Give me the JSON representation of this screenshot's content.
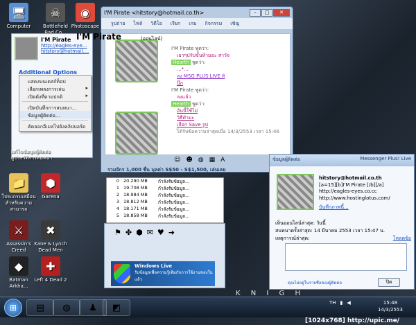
{
  "desktop_icons": [
    {
      "label": "Computer",
      "icon": "computer-icon",
      "glyph": "🖥",
      "color": "#5b8fd1"
    },
    {
      "label": "Battlefield Bad Co...",
      "icon": "game-icon",
      "glyph": "☠",
      "color": "#555555"
    },
    {
      "label": "Photoscape",
      "icon": "photoscape-icon",
      "glyph": "◉",
      "color": "#e04a3a"
    },
    {
      "label": "โปรแกรมเสมือน สำหรับความสามารถ",
      "icon": "folder-icon",
      "glyph": "📁",
      "color": "#e8c35a"
    },
    {
      "label": "Garena",
      "icon": "garena-icon",
      "glyph": "⬢",
      "color": "#c0282b"
    },
    {
      "label": "Assassin's Creed",
      "icon": "assassin-icon",
      "glyph": "⚔",
      "color": "#7a1d1d"
    },
    {
      "label": "Kane & Lynch Dead Men",
      "icon": "kane-lynch-icon",
      "glyph": "✖",
      "color": "#3a3a3a"
    },
    {
      "label": "Batman Arkha...",
      "icon": "batman-icon",
      "glyph": "◆",
      "color": "#222222"
    },
    {
      "label": "Left 4 Dead 2",
      "icon": "left4dead-icon",
      "glyph": "✚",
      "color": "#b32020"
    }
  ],
  "contact_card": {
    "name": "I'M Pirate",
    "link": "http://eagles-eye...",
    "email": "hitstory@hotmail....",
    "additional_options": "Additional Options",
    "footer_line1": "แก้ไขข้อมูลผู้ติดต่อ",
    "footer_line2": "ดูประวัติการสนทนา"
  },
  "context_menu": {
    "items": [
      {
        "label": "แสดงบนเดสก์ท็อป",
        "submenu": false
      },
      {
        "label": "เลือกเพลงการเล่น",
        "submenu": true
      },
      {
        "label": "เปิดดังที่ตามปกติ",
        "submenu": true
      },
      {
        "label": "เปิดบันทึกการสนทนา...",
        "submenu": false,
        "separator_before": true
      },
      {
        "label": "ข้อมูลผู้ติดต่อ...",
        "submenu": false,
        "selected": true
      },
      {
        "label": "คัดลอกอีเมลไปยังคลิปบอร์ด",
        "submenu": false,
        "separator_before": true
      }
    ]
  },
  "chat_window": {
    "title": "I'M Pirate  <hitstory@hotmail.co.th>",
    "menu": [
      "รูปถ่าย",
      "ไฟล์",
      "วิดีโอ",
      "เรียก",
      "เกม",
      "กิจกรรม",
      "เชิญ"
    ],
    "header_name": "I'M Pirate",
    "header_status": "(ออนไลน์)",
    "messages": [
      {
        "speaker": "I'M Pirate",
        "says": "พูดว่า:"
      },
      {
        "text": "เอาๆปรับขั้นห้ามอะ สาวัจ",
        "style": "msg"
      },
      {
        "text": "Hearth",
        "style": "hl",
        "suffix": "พูดว่า:"
      },
      {
        "text": "...*...",
        "style": "msg"
      },
      {
        "text": "ลง MSG PLUS LIVE สิ",
        "style": "msg purple ul"
      },
      {
        "text": "นึก",
        "style": "msg ul"
      },
      {
        "speaker": "I'M Pirate",
        "says": "พูดว่า:"
      },
      {
        "text": "ลงแล้ว",
        "style": "msg"
      },
      {
        "text": "Hearth",
        "style": "hl",
        "suffix": "พูดว่า:"
      },
      {
        "text": "อันนี้ใช้ไม่",
        "style": "msg ul"
      },
      {
        "text": "วิธีทำมะ",
        "style": "msg ul"
      },
      {
        "text": "เลือก Save รูป",
        "style": "msg ul"
      }
    ],
    "last_received": "ได้รับข้อความล่าสุดเมื่อ 14/3/2553 เวลา 15:46",
    "status_bar": "รวมจักร 1,000 ชื่น  มุลค่า S$50 - S$1,500, เล่นเลย"
  },
  "downloads": [
    {
      "n": "0",
      "size": "20.290 MB",
      "status": "กำลังรับข้อมูล..."
    },
    {
      "n": "1",
      "size": "19.708 MB",
      "status": "กำลังรับข้อมูล..."
    },
    {
      "n": "2",
      "size": "18.984 MB",
      "status": "กำลังรับข้อมูล..."
    },
    {
      "n": "3",
      "size": "18.812 MB",
      "status": "กำลังรับข้อมูล..."
    },
    {
      "n": "4",
      "size": "18.171 MB",
      "status": "กำลังรับข้อมูล..."
    },
    {
      "n": "5",
      "size": "18.858 MB",
      "status": "กำลังรับข้อมูล..."
    }
  ],
  "banner": {
    "text": "รับข้อมูลเพื่อความรู้เพิ่มกับการใช้งานของในแล้ว",
    "logo": "Windows Live"
  },
  "mp_popup": {
    "title": "ข้อมูลผู้ติดต่อ",
    "brand": "Messenger Plus! Live",
    "email": "hitstory@hotmail.co.th",
    "line2": "[a=15][b]I'M Pirate [/b][/a]",
    "line3": "http://eagles-eyes.co.cc",
    "line4": "http://www.hostinglotus.com/",
    "change_pic": "บันทึกภาพนี้...",
    "seen_online": "เห็นออนไลน์ล่าสุด: วันนี้",
    "last_chat": "สนทนาครั้งล่าสุด: 14 มีนาคม 2553 เวลา 15:47 น.",
    "note_label": "เหตุการณ์ล่าสุด:",
    "note_link": "โหลดข้อ",
    "foot": "คุณไม่อยู่ในรายชื่อของผู้ติดต่อ",
    "ok": "ปิด"
  },
  "taskbar": {
    "lang": "TH",
    "time": "15:48",
    "date": "14/3/2553"
  },
  "watermark": "[1024x768] http://upic.me/",
  "wallpaper_text": "K N I G H"
}
